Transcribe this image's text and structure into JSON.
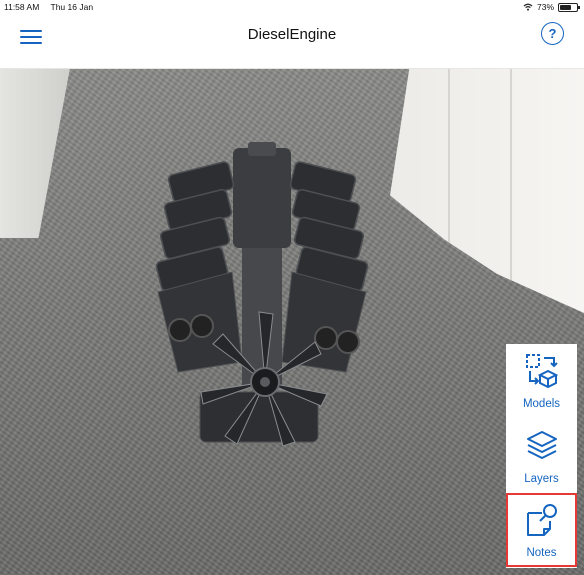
{
  "status_bar": {
    "time": "11:58 AM",
    "date": "Thu 16 Jan",
    "battery": "73%",
    "battery_level": 0.73
  },
  "navbar": {
    "title": "DieselEngine",
    "menu_icon": "hamburger-menu-icon",
    "help_icon": "help-question-icon",
    "help_glyph": "?"
  },
  "toolbar": {
    "items": [
      {
        "label": "Models",
        "icon": "models-icon",
        "selected": false
      },
      {
        "label": "Layers",
        "icon": "layers-icon",
        "selected": false
      },
      {
        "label": "Notes",
        "icon": "notes-icon",
        "selected": true
      }
    ]
  },
  "colors": {
    "accent": "#1565c0",
    "highlight": "#e53935"
  }
}
